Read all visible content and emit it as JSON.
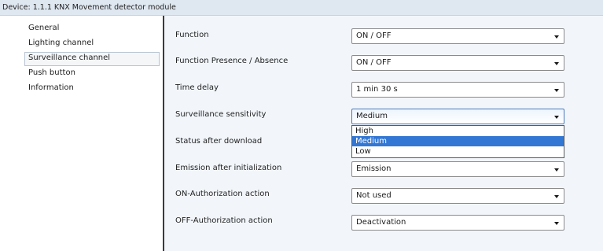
{
  "window": {
    "title": "Device: 1.1.1  KNX Movement detector module"
  },
  "nav": {
    "items": [
      {
        "label": "General"
      },
      {
        "label": "Lighting channel"
      },
      {
        "label": "Surveillance channel"
      },
      {
        "label": "Push button"
      },
      {
        "label": "Information"
      }
    ],
    "selected": "Surveillance channel"
  },
  "params": [
    {
      "label": "Function",
      "value": "ON / OFF"
    },
    {
      "label": "Function Presence / Absence",
      "value": "ON / OFF"
    },
    {
      "label": "Time delay",
      "value": "1 min 30 s"
    },
    {
      "label": "Surveillance sensitivity",
      "value": "Medium"
    },
    {
      "label": "Status after download",
      "value": ""
    },
    {
      "label": "Emission after initialization",
      "value": "Emission"
    },
    {
      "label": "ON-Authorization action",
      "value": "Not used"
    },
    {
      "label": "OFF-Authorization action",
      "value": "Deactivation"
    }
  ],
  "dropdown": {
    "options": [
      "High",
      "Medium",
      "Low"
    ],
    "highlighted": "Medium"
  },
  "icons": {
    "select_arrow": "chevron-down-icon"
  },
  "colors": {
    "highlight": "#3277d4",
    "content_bg": "#f2f6fb",
    "title_bg": "#dfe7f0"
  }
}
